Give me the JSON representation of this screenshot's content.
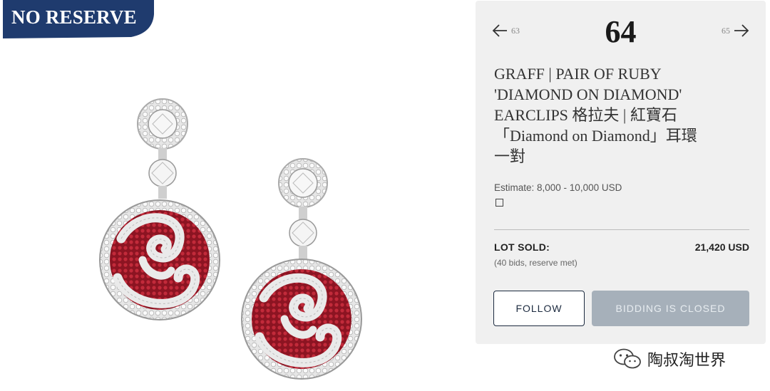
{
  "badge": {
    "text": "NO RESERVE",
    "color": "#1f3b6e"
  },
  "lot": {
    "number": "64",
    "prev": "63",
    "next": "65",
    "title_lines": [
      "GRAFF | PAIR OF RUBY",
      "'DIAMOND ON DIAMOND'",
      "EARCLIPS 格拉夫 | 紅寶石",
      "「Diamond on Diamond」耳環",
      "一對"
    ],
    "estimate": "Estimate: 8,000 - 10,000 USD",
    "sold_label": "LOT SOLD:",
    "sold_price": "21,420 USD",
    "sold_note": "(40 bids, reserve met)"
  },
  "buttons": {
    "follow": "FOLLOW",
    "closed": "BIDDING IS CLOSED"
  },
  "icons": {
    "prev": "arrow-left-icon",
    "next": "arrow-right-icon",
    "watermark": "wechat-icon"
  },
  "watermark": {
    "text": "陶叔淘世界"
  },
  "colors": {
    "panel_bg": "#f0f0f0",
    "button_dark": "#1c2a3f",
    "button_disabled": "#a6b0ba",
    "ruby": "#9e1b2a"
  }
}
